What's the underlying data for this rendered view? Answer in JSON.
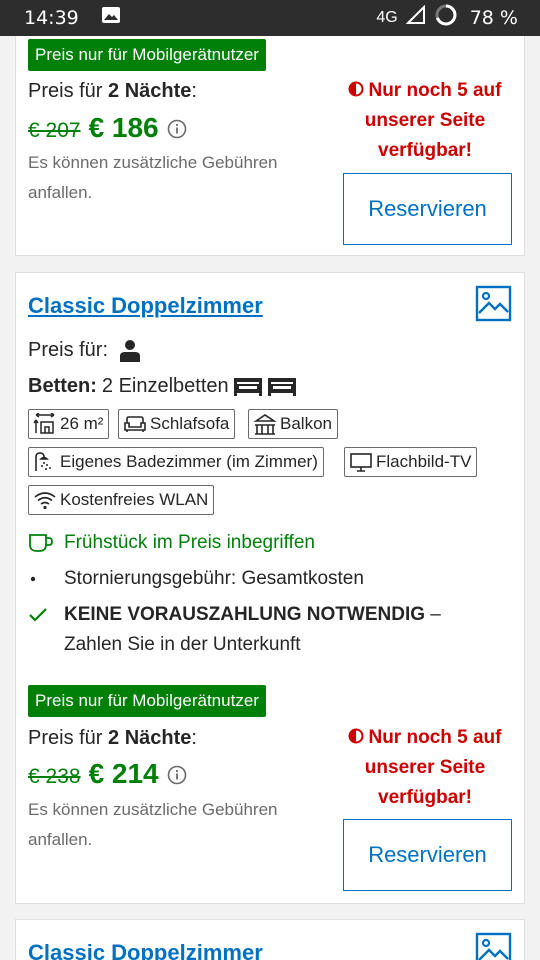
{
  "status_bar": {
    "time": "14:39",
    "network": "4G",
    "battery": "78 %"
  },
  "offers": [
    {
      "mobile_badge": "Preis nur für Mobilgerätnutzer",
      "price_for_prefix": "Preis für ",
      "price_for_nights": "2 Nächte",
      "price_for_suffix": ":",
      "old_price": "€ 207",
      "new_price": "€ 186",
      "fees_note": "Es können zusätzliche Gebühren anfallen.",
      "scarcity": "Nur noch 5 auf unserer Seite verfügbar!",
      "reserve_label": "Reservieren"
    },
    {
      "room_title": "Classic Doppelzimmer",
      "preis_fuer_label": "Preis für:",
      "occupancy_icon": "person-icon",
      "beds_label": "Betten:",
      "beds_value": "2 Einzelbetten",
      "amenities": [
        {
          "label": "26 m²",
          "icon": "room-size-icon"
        },
        {
          "label": "Schlafsofa",
          "icon": "sofa-icon"
        },
        {
          "label": "Balkon",
          "icon": "balcony-icon"
        },
        {
          "label": "Eigenes Badezimmer (im Zimmer)",
          "icon": "shower-icon"
        },
        {
          "label": "Flachbild-TV",
          "icon": "tv-icon"
        },
        {
          "label": "Kostenfreies WLAN",
          "icon": "wifi-icon"
        }
      ],
      "breakfast": "Frühstück im Preis inbegriffen",
      "cancellation": "Stornierungsgebühr: Gesamtkosten",
      "no_prepayment_bold": "KEINE VORAUSZAHLUNG NOTWENDIG",
      "no_prepayment_rest": " – Zahlen Sie in der Unterkunft",
      "mobile_badge": "Preis nur für Mobilgerätnutzer",
      "price_for_prefix": "Preis für ",
      "price_for_nights": "2 Nächte",
      "price_for_suffix": ":",
      "old_price": "€ 238",
      "new_price": "€ 214",
      "fees_note": "Es können zusätzliche Gebühren anfallen.",
      "scarcity": "Nur noch 5 auf unserer Seite verfügbar!",
      "reserve_label": "Reservieren"
    },
    {
      "room_title": "Classic Doppelzimmer"
    }
  ],
  "colors": {
    "green": "#008009",
    "blue": "#0071c2",
    "red": "#cc0000"
  }
}
